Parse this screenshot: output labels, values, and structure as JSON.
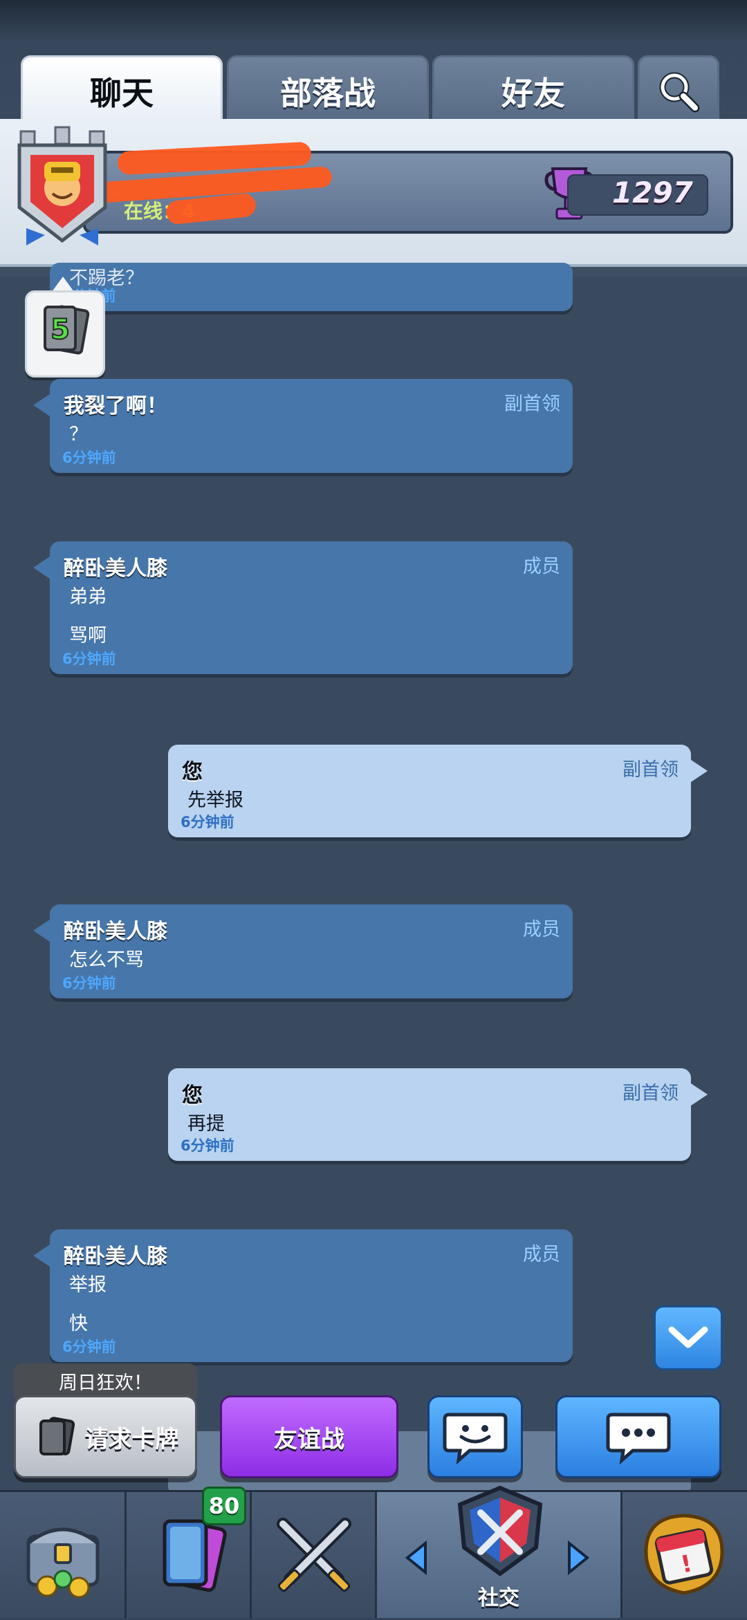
{
  "tabs": [
    {
      "label": "聊天",
      "active": true
    },
    {
      "label": "部落战",
      "active": false
    },
    {
      "label": "好友",
      "active": false
    }
  ],
  "header": {
    "online_label": "在线：4",
    "trophies": "1297",
    "trophy_color": "#b25ad9"
  },
  "card_request_count": "5",
  "messages": [
    {
      "sender": "",
      "role": "",
      "lines": [
        "不踢老？"
      ],
      "time": "6分钟前",
      "style": "dark"
    },
    {
      "sender": "我裂了啊！",
      "role": "副首领",
      "lines": [
        "？"
      ],
      "time": "6分钟前",
      "style": "dark"
    },
    {
      "sender": "醉卧美人膝",
      "role": "成员",
      "lines": [
        "弟弟",
        "骂啊"
      ],
      "time": "6分钟前",
      "style": "dark"
    },
    {
      "sender": "您",
      "role": "副首领",
      "lines": [
        "先举报"
      ],
      "time": "6分钟前",
      "style": "light"
    },
    {
      "sender": "醉卧美人膝",
      "role": "成员",
      "lines": [
        "怎么不骂"
      ],
      "time": "6分钟前",
      "style": "dark"
    },
    {
      "sender": "您",
      "role": "副首领",
      "lines": [
        "再提"
      ],
      "time": "6分钟前",
      "style": "light"
    },
    {
      "sender": "醉卧美人膝",
      "role": "成员",
      "lines": [
        "举报",
        "快"
      ],
      "time": "6分钟前",
      "style": "dark"
    }
  ],
  "bottom_actions": {
    "sunday_label": "周日狂欢！",
    "request_cards": "请求卡牌",
    "friendly_battle": "友谊战"
  },
  "nav": {
    "cards_badge": "80",
    "social_label": "社交",
    "icons": [
      "shop-chest-icon",
      "cards-icon",
      "battle-swords-icon",
      "social-clan-icon",
      "events-icon"
    ]
  }
}
